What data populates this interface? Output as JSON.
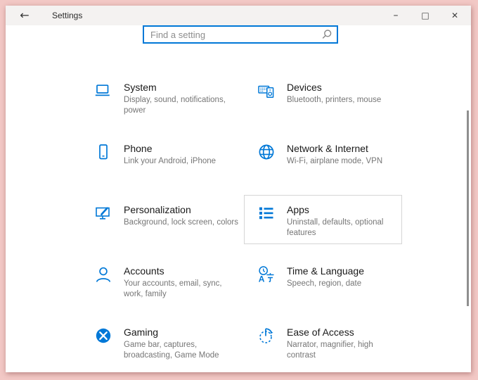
{
  "window": {
    "title": "Settings",
    "back_glyph": "←",
    "controls": {
      "minimize": "–",
      "maximize": "□",
      "close": "✕"
    }
  },
  "search": {
    "placeholder": "Find a setting"
  },
  "tiles": [
    {
      "name": "system",
      "title": "System",
      "subtitle": "Display, sound, notifications, power"
    },
    {
      "name": "devices",
      "title": "Devices",
      "subtitle": "Bluetooth, printers, mouse"
    },
    {
      "name": "phone",
      "title": "Phone",
      "subtitle": "Link your Android, iPhone"
    },
    {
      "name": "network",
      "title": "Network & Internet",
      "subtitle": "Wi-Fi, airplane mode, VPN"
    },
    {
      "name": "personalization",
      "title": "Personalization",
      "subtitle": "Background, lock screen, colors"
    },
    {
      "name": "apps",
      "title": "Apps",
      "subtitle": "Uninstall, defaults, optional features",
      "highlighted": true
    },
    {
      "name": "accounts",
      "title": "Accounts",
      "subtitle": "Your accounts, email, sync, work, family"
    },
    {
      "name": "time-language",
      "title": "Time & Language",
      "subtitle": "Speech, region, date"
    },
    {
      "name": "gaming",
      "title": "Gaming",
      "subtitle": "Game bar, captures, broadcasting, Game Mode"
    },
    {
      "name": "ease-of-access",
      "title": "Ease of Access",
      "subtitle": "Narrator, magnifier, high contrast"
    }
  ],
  "colors": {
    "accent": "#0078d7",
    "frame": "#f2c8c5",
    "titlebar_bg": "#f4f2f1",
    "title_text": "#191919",
    "subtitle_text": "#767676",
    "scrollbar": "#8f8f8f"
  }
}
